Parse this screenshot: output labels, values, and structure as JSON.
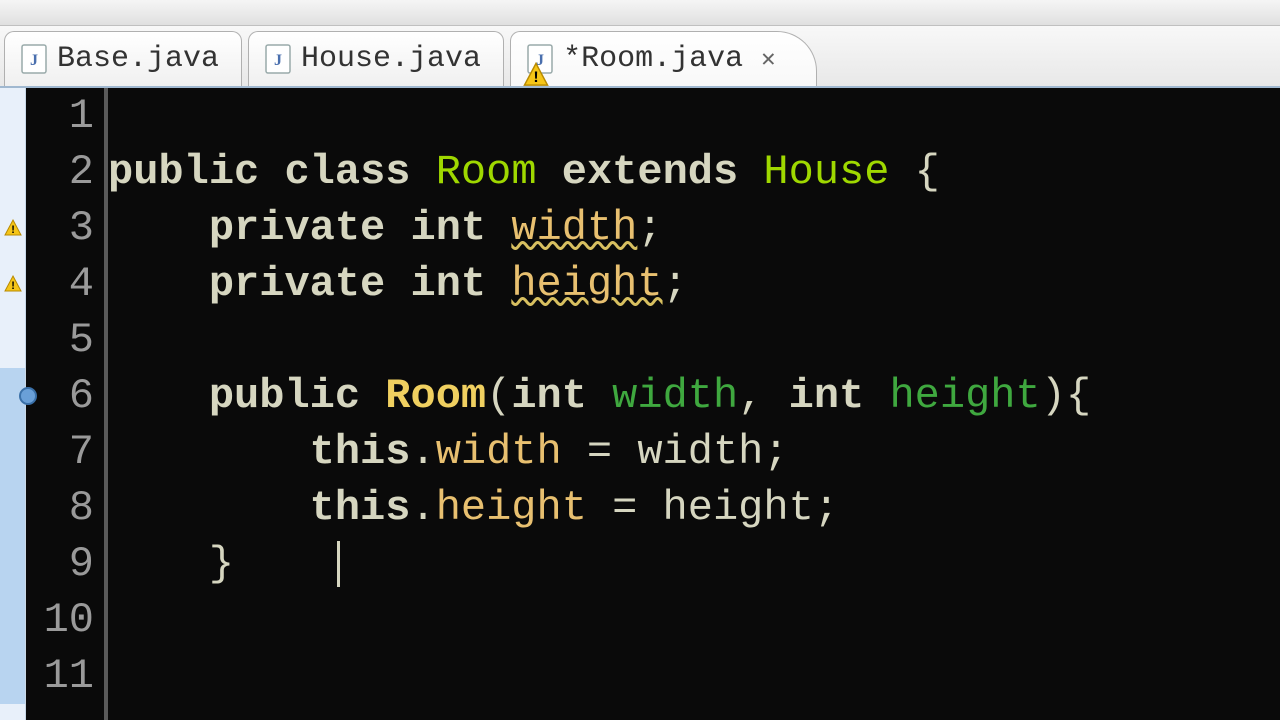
{
  "tabs": [
    {
      "label": "Base.java",
      "active": false,
      "warning": false
    },
    {
      "label": "House.java",
      "active": false,
      "warning": false
    },
    {
      "label": "*Room.java",
      "active": true,
      "warning": true
    }
  ],
  "gutter": {
    "lines": [
      "1",
      "2",
      "3",
      "4",
      "5",
      "6",
      "7",
      "8",
      "9",
      "10",
      "11"
    ]
  },
  "code": {
    "l2": {
      "kw1": "public",
      "kw2": "class",
      "name": "Room",
      "kw3": "extends",
      "sup": "House",
      "open": " {"
    },
    "l3": {
      "kw1": "private",
      "kw2": "int",
      "fld": "width",
      "end": ";"
    },
    "l4": {
      "kw1": "private",
      "kw2": "int",
      "fld": "height",
      "end": ";"
    },
    "l6": {
      "kw1": "public",
      "ctor": "Room",
      "open": "(",
      "t1": "int",
      "p1": "width",
      "sep": ", ",
      "t2": "int",
      "p2": "height",
      "close": "){"
    },
    "l7": {
      "this": "this",
      "dot": ".",
      "fld": "width",
      "eq": " = ",
      "var": "width",
      "end": ";"
    },
    "l8": {
      "this": "this",
      "dot": ".",
      "fld": "height",
      "eq": " = ",
      "var": "height",
      "end": ";"
    },
    "l9": {
      "close": "}"
    }
  },
  "markers": {
    "line3": "warning",
    "line4": "warning",
    "line6": "method"
  },
  "colors": {
    "bg": "#0a0a0a",
    "keyword": "#d6d6c0",
    "class": "#9fd800",
    "field": "#e8c070",
    "param": "#3fa83f"
  }
}
